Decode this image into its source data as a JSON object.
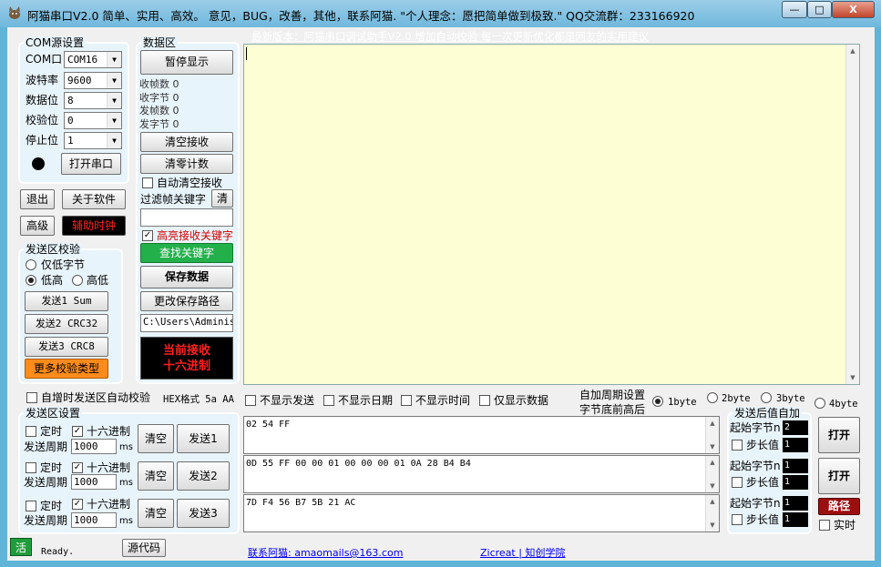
{
  "window": {
    "title": "阿猫串口V2.0  简单、实用、高效。 意见，BUG，改善，其他，联系阿猫. \"个人理念：愿把简单做到极致.\"  QQ交流群：233166920",
    "minimize": "—",
    "maximize": "□",
    "close": "X"
  },
  "com_group": {
    "title": "COM源设置",
    "rows": [
      {
        "label": "COM口",
        "value": "COM16"
      },
      {
        "label": "波特率",
        "value": "9600"
      },
      {
        "label": "数据位",
        "value": "8"
      },
      {
        "label": "校验位",
        "value": "0"
      },
      {
        "label": "停止位",
        "value": "1"
      }
    ],
    "open_button": "打开串口"
  },
  "left_buttons": {
    "exit": "退出",
    "about": "关于软件",
    "advanced": "高级",
    "aux_clock": "辅助时钟"
  },
  "checksum_group": {
    "title": "发送区校验",
    "low_byte_only": "仅低字节",
    "low_high": "低高",
    "high_low": "高低",
    "send1": "发送1 Sum",
    "send2": "发送2 CRC32",
    "send3": "发送3 CRC8",
    "more": "更多校验类型"
  },
  "data_group": {
    "title": "数据区",
    "pause": "暂停显示",
    "stats": [
      "收帧数 0",
      "收字节 0",
      "发帧数 0",
      "发字节 0"
    ],
    "clear_recv": "清空接收",
    "clear_count": "清零计数",
    "auto_clear": "自动清空接收",
    "filter_label": "过滤帧关键字",
    "filter_clear": "清",
    "highlight": "高亮接收关键字",
    "find_keyword": "查找关键字",
    "save_data": "保存数据",
    "change_path": "更改保存路径",
    "path": "C:\\Users\\Adminis",
    "recv_mode": [
      "当前接收",
      "十六进制"
    ]
  },
  "top_link": "最新版本：阿猫串口调试助手V2.0 增加自动校验 每一次更新优化都是网友的实用建议",
  "options_row": {
    "auto_inc": "自增时发送区自动校验",
    "hex_fmt": "HEX格式 5a AA",
    "no_send": "不显示发送",
    "no_date": "不显示日期",
    "no_time": "不显示时间",
    "only_data": "仅显示数据",
    "auto_period": "自加周期设置",
    "byte_order": "字节底前高后",
    "b1": "1byte",
    "b2": "2byte",
    "b3": "3byte",
    "b4": "4byte"
  },
  "send_group": {
    "title": "发送区设置",
    "timed": "定时",
    "hex": "十六进制",
    "period": "发送周期",
    "ms": "ms",
    "clear": "清空",
    "rows": [
      {
        "period": "1000",
        "send": "发送1",
        "data": "02 54 FF"
      },
      {
        "period": "1000",
        "send": "发送2",
        "data": "0D 55 FF 00 00 01 00 00 00 01 0A 28 B4 B4"
      },
      {
        "period": "1000",
        "send": "发送3",
        "data": "7D F4 56 B7 5B 21 AC"
      }
    ]
  },
  "post_group": {
    "title": "发送后值自加",
    "start_byte": "起始字节n",
    "step": "步长值",
    "rows": [
      {
        "start": "2",
        "step": "1"
      },
      {
        "start": "1",
        "step": "1"
      },
      {
        "start": "1",
        "step": "1"
      }
    ],
    "open": "打开",
    "path": "路径",
    "realtime": "实时"
  },
  "status": {
    "live": "活",
    "ready": "Ready.",
    "source": "源代码",
    "contact": "联系阿猫: amaomails@163.com",
    "author": "Zicreat | 知创学院"
  },
  "colors": {
    "recv_bg": "#fefed5",
    "aux_bg": "#000000",
    "aux_fg": "#ff2020",
    "find_bg": "#22b04b",
    "more_bg": "#ff8c1a",
    "live_bg": "#1f9d3a",
    "path_bg": "#9c0f0f"
  }
}
